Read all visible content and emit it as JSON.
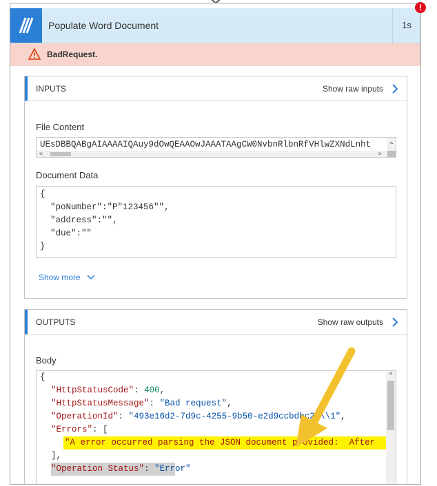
{
  "action": {
    "title": "Populate Word Document",
    "duration": "1s",
    "alert_badge": "!",
    "error": "BadRequest."
  },
  "inputs": {
    "header": "INPUTS",
    "raw_link": "Show raw inputs",
    "file_content_label": "File Content",
    "file_content_value": "UEsDBBQABgAIAAAAIQAuy9dOwQEAAOwJAAATAAgCW0NvbnRlbnRfVHlwZXNdLnht",
    "document_data_label": "Document Data",
    "document_data_lines": [
      "{",
      "  \"poNumber\":\"P\"123456\"\",",
      "  \"address\":\"\",",
      "  \"due\":\"\"",
      "}"
    ],
    "show_more": "Show more"
  },
  "outputs": {
    "header": "OUTPUTS",
    "raw_link": "Show raw outputs",
    "body_label": "Body",
    "brace_open": "{",
    "k_status_code": "\"HttpStatusCode\"",
    "v_status_code": "400",
    "k_status_msg": "\"HttpStatusMessage\"",
    "v_status_msg": "\"Bad request\"",
    "k_operation_id": "\"OperationId\"",
    "v_operation_id": "\"493e16d2-7d9c-4255-9b50-e2d9ccbdbc22\\\\1\"",
    "k_errors": "\"Errors\"",
    "errors_open": "[",
    "error_message": "\"A error occurred parsing the JSON document provided:  After",
    "errors_close": "],",
    "k_operation_status": "\"Operation Status\"",
    "v_operation_status": "\"Error\""
  },
  "colors": {
    "accent": "#2b7fd6",
    "error_bg": "#f8d4cc",
    "header_bg": "#d6ebf7",
    "highlight": "#fff200",
    "annotation_arrow": "#f2c12e"
  }
}
